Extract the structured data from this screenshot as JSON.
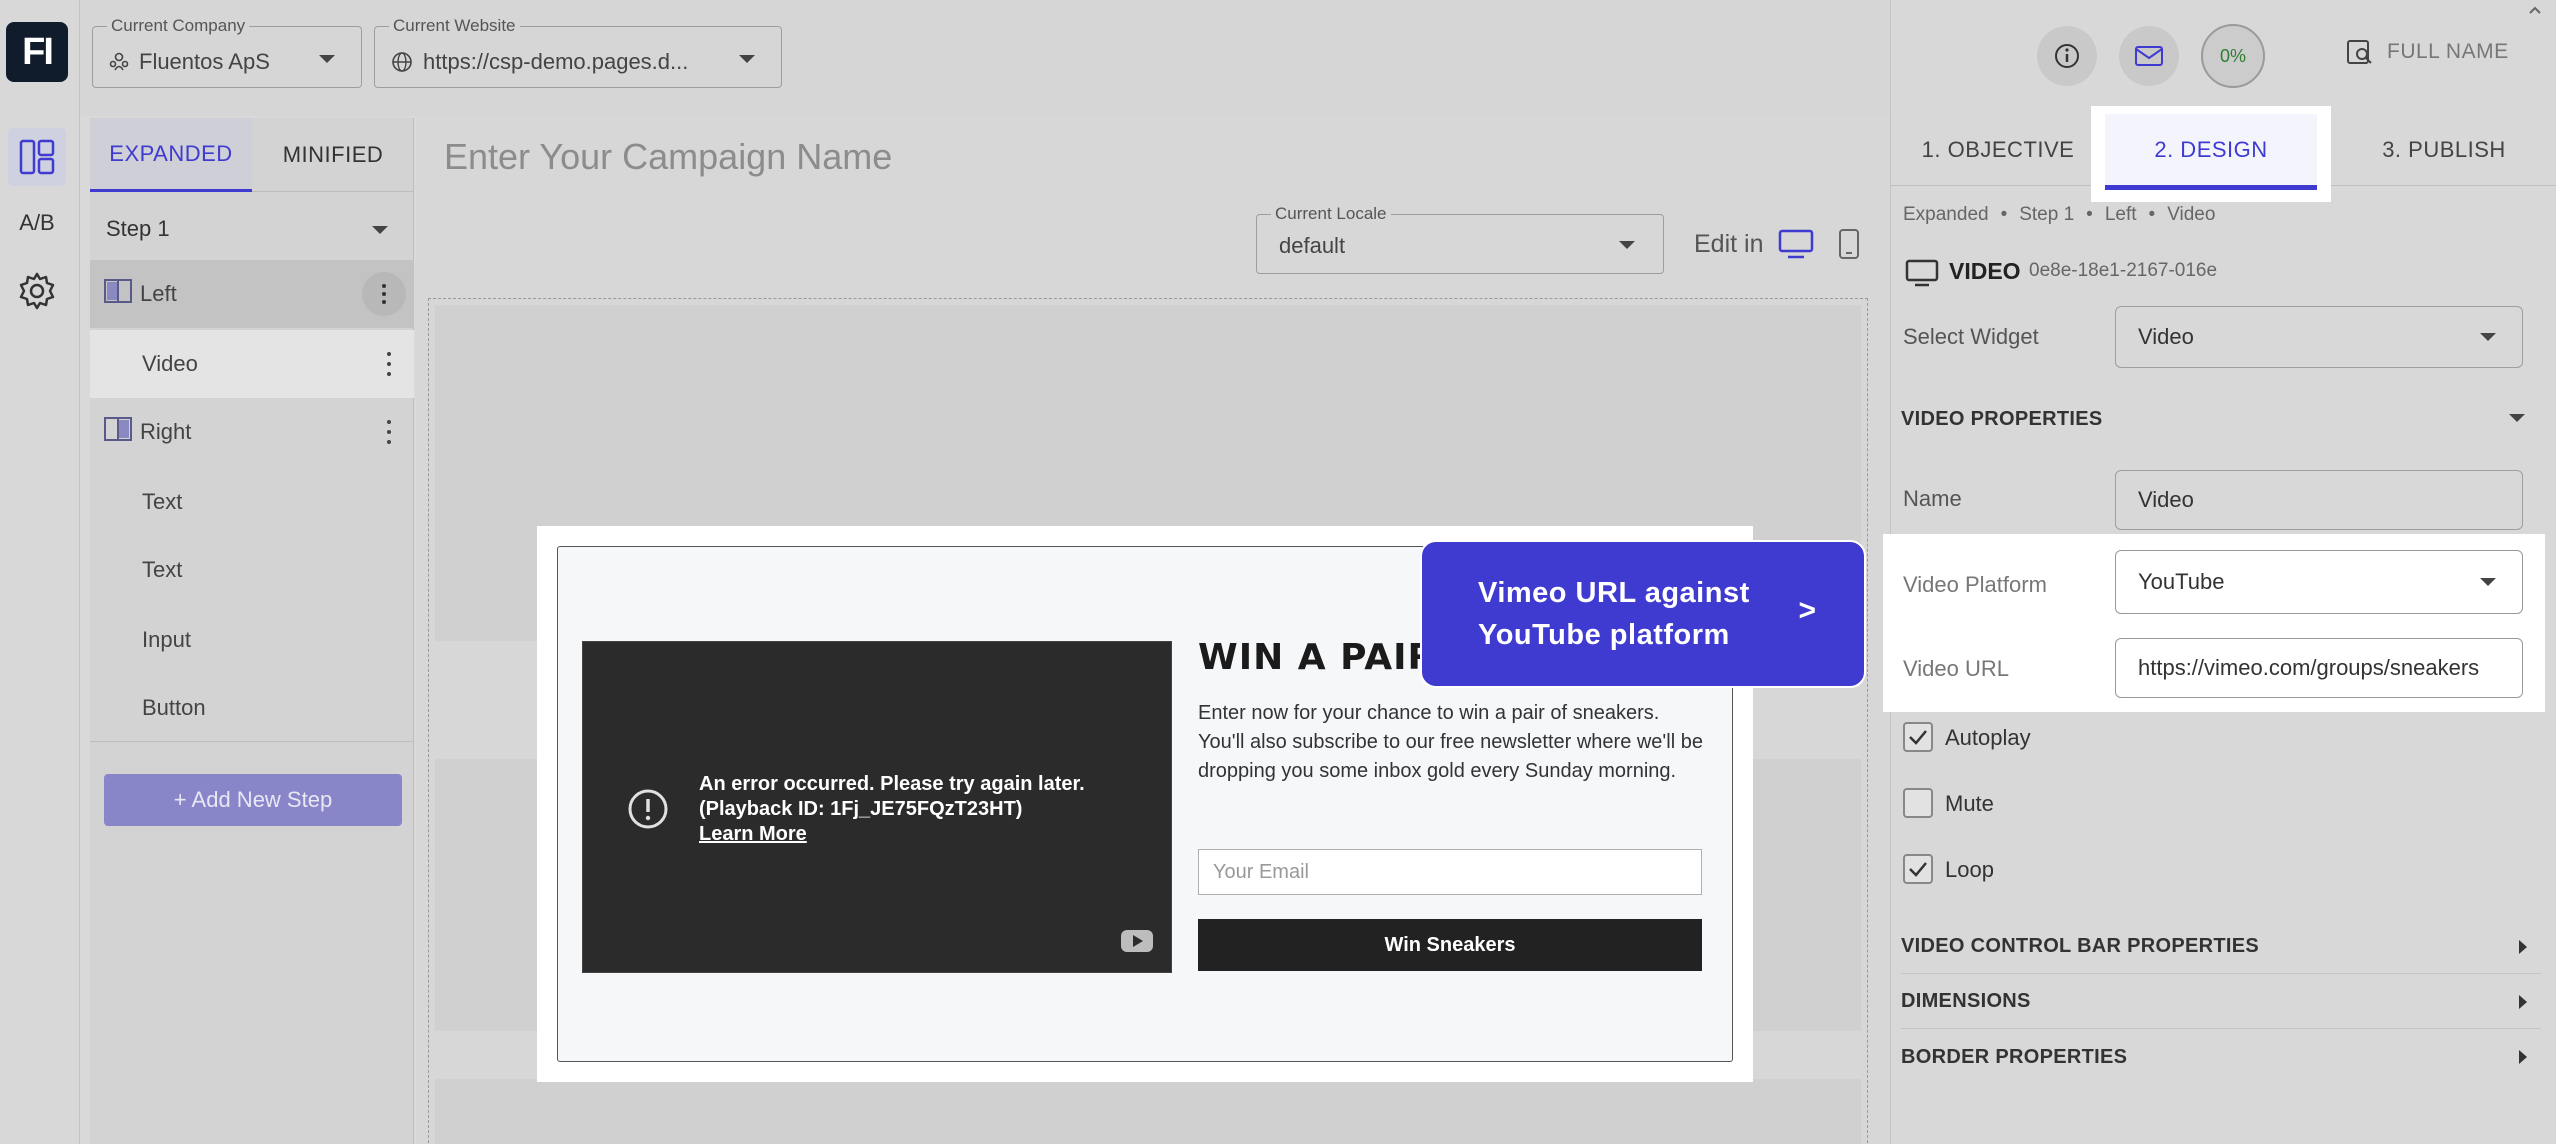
{
  "rail": {
    "logo": "FI",
    "ab_label": "A/B"
  },
  "topbar": {
    "company_label": "Current Company",
    "company_value": "Fluentos ApS",
    "website_label": "Current Website",
    "website_value": "https://csp-demo.pages.d...",
    "progress": "0%",
    "user_name": "FULL NAME"
  },
  "steps_panel": {
    "tabs": [
      "EXPANDED",
      "MINIFIED"
    ],
    "step_select": "Step 1",
    "items": [
      {
        "label": "Left"
      },
      {
        "label": "Video"
      },
      {
        "label": "Right"
      },
      {
        "label": "Text"
      },
      {
        "label": "Text"
      },
      {
        "label": "Input"
      },
      {
        "label": "Button"
      }
    ],
    "add_step": "+ Add New Step"
  },
  "canvas": {
    "campaign_placeholder": "Enter Your Campaign Name",
    "locale_label": "Current Locale",
    "locale_value": "default",
    "edit_in": "Edit in"
  },
  "preview": {
    "video_error_line1": "An error occurred. Please try again later.",
    "video_error_line2": "(Playback ID: 1Fj_JE75FQzT23HT)",
    "video_learn_more": "Learn More",
    "headline": "WIN A PAIR O",
    "body": "Enter now for your chance to win a pair of sneakers. You'll also subscribe to our free newsletter where we'll be dropping you some inbox gold every Sunday morning.",
    "email_placeholder": "Your Email",
    "cta": "Win Sneakers"
  },
  "callout": {
    "line1": "Vimeo URL against",
    "line2": "YouTube platform",
    "arrow": ">"
  },
  "right_panel": {
    "tabs": [
      "1. OBJECTIVE",
      "2. DESIGN",
      "3. PUBLISH"
    ],
    "breadcrumb": [
      "Expanded",
      "Step 1",
      "Left",
      "Video"
    ],
    "widget_title": "VIDEO",
    "widget_id": "0e8e-18e1-2167-016e",
    "select_widget_label": "Select Widget",
    "select_widget_value": "Video",
    "video_properties": "VIDEO PROPERTIES",
    "name_label": "Name",
    "name_value": "Video",
    "platform_label": "Video Platform",
    "platform_value": "YouTube",
    "url_label": "Video URL",
    "url_value": "https://vimeo.com/groups/sneakers",
    "autoplay": "Autoplay",
    "mute": "Mute",
    "loop": "Loop",
    "control_bar": "VIDEO CONTROL BAR PROPERTIES",
    "dimensions": "DIMENSIONS",
    "border": "BORDER PROPERTIES"
  },
  "colors": {
    "accent": "#3f3bd0",
    "dark_navy": "#101c2b",
    "cta_dark": "#222222"
  }
}
